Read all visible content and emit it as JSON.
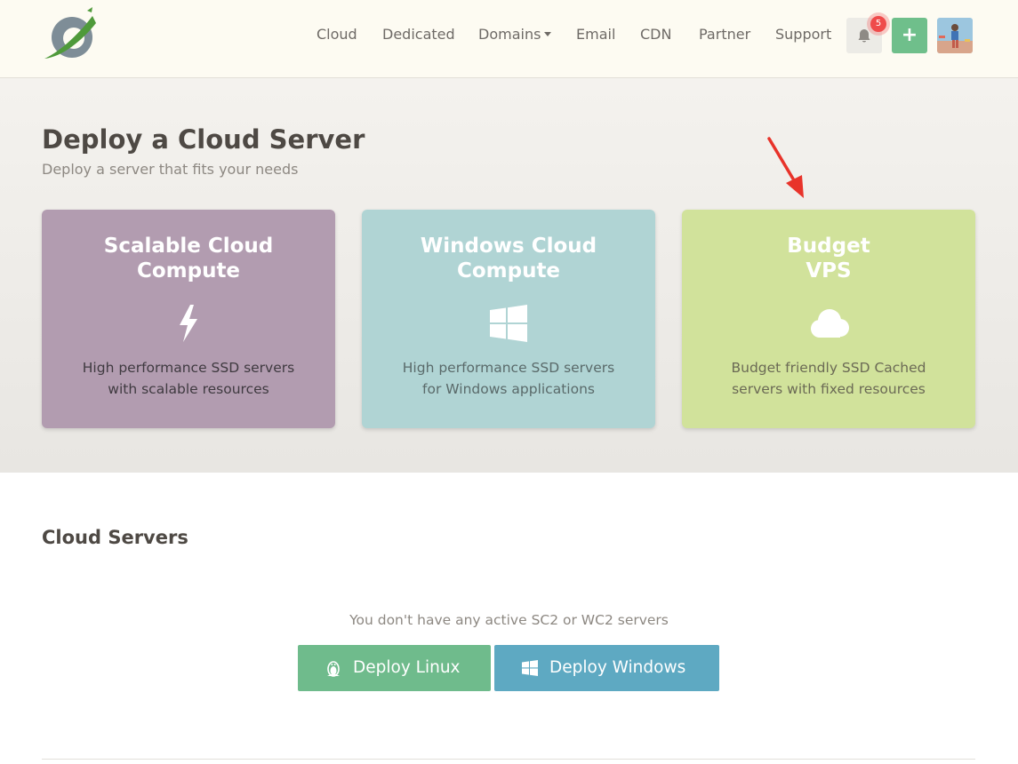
{
  "nav": {
    "items": [
      {
        "label": "Cloud"
      },
      {
        "label": "Dedicated"
      },
      {
        "label": "Domains"
      },
      {
        "label": "Email"
      },
      {
        "label": "CDN"
      },
      {
        "label": "Partner"
      },
      {
        "label": "Support"
      }
    ],
    "notification_count": "5",
    "add_label": "+"
  },
  "hero": {
    "title": "Deploy a Cloud Server",
    "subtitle": "Deploy a server that fits your needs",
    "cards": [
      {
        "title_line1": "Scalable Cloud",
        "title_line2": "Compute",
        "desc_line1": "High performance SSD servers",
        "desc_line2": "with scalable resources",
        "icon": "lightning-icon",
        "color": "#b29cb0"
      },
      {
        "title_line1": "Windows Cloud",
        "title_line2": "Compute",
        "desc_line1": "High performance SSD servers",
        "desc_line2": "for Windows applications",
        "icon": "windows-icon",
        "color": "#b0d4d4"
      },
      {
        "title_line1": "Budget",
        "title_line2": "VPS",
        "desc_line1": "Budget friendly SSD Cached",
        "desc_line2": "servers with fixed resources",
        "icon": "cloud-icon",
        "color": "#d1e29b"
      }
    ]
  },
  "servers": {
    "title": "Cloud Servers",
    "empty_message": "You don't have any active SC2 or WC2 servers",
    "deploy_linux_label": "Deploy Linux",
    "deploy_windows_label": "Deploy Windows"
  },
  "colors": {
    "header_bg": "#fdfbf2",
    "accent_green": "#6fbf8b",
    "accent_blue": "#5ea9c2",
    "badge_red": "#ef4b4b",
    "arrow_red": "#e8332a"
  }
}
